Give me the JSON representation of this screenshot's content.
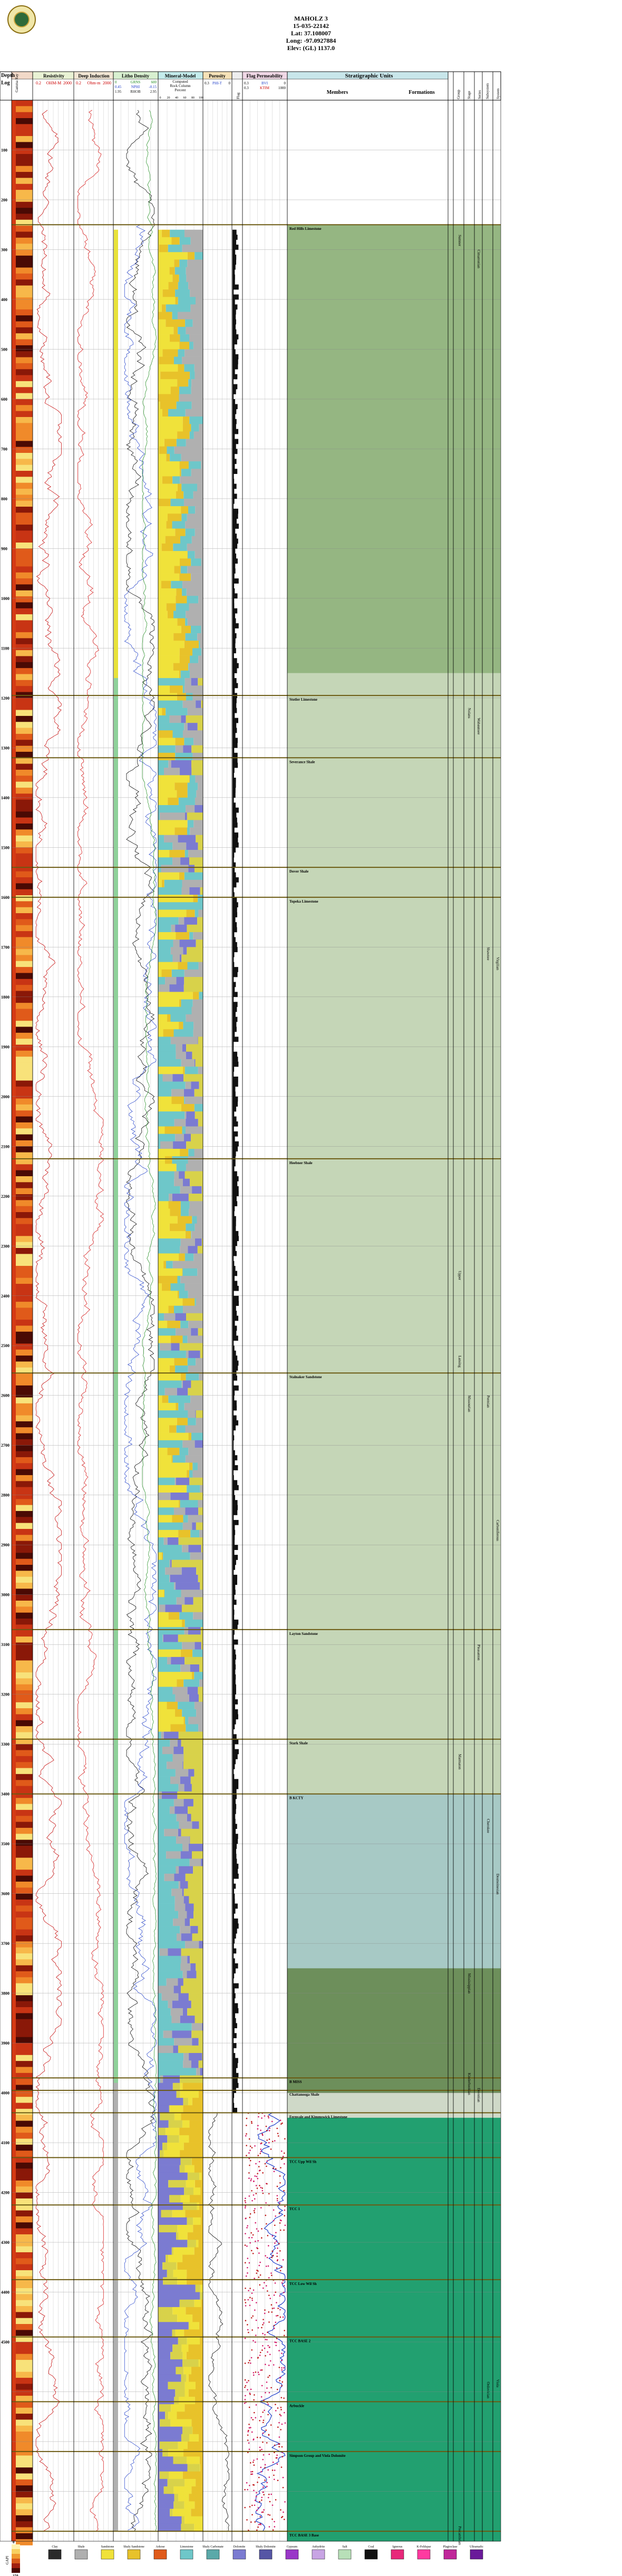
{
  "header": {
    "well_name": "MAHOLZ 3",
    "api": "15-035-22142",
    "lat": "Lat: 37.108007",
    "long": "Long: -97.0927884",
    "elev": "Elev: (GL) 1137.0"
  },
  "columns": {
    "depth": "Depth",
    "log": "Log",
    "gamma_ray": "Gamma Ray",
    "gr_scale": [
      "0",
      "GAPI",
      "150"
    ],
    "resistivity": "Resistivity",
    "res_scale": [
      "0.2",
      "OHM-M",
      "2000"
    ],
    "deep_induction": "Deep Induction",
    "deep_scale": [
      "0.2",
      "Ohm-m",
      "2000"
    ],
    "litho_density": "Litho Density",
    "ld_curves": [
      {
        "name": "GRNS",
        "range": [
          "0",
          "600"
        ]
      },
      {
        "name": "NPHI",
        "range": [
          "0.45",
          "-0.15"
        ]
      },
      {
        "name": "RHOB",
        "range": [
          "1.95",
          "2.95"
        ]
      }
    ],
    "mineral_model": "Mineral-Model",
    "mm_sub": [
      "Computed",
      "Rock Column",
      "Percent"
    ],
    "mm_ticks": [
      "0",
      "20",
      "40",
      "60",
      "80",
      "100"
    ],
    "porosity": "Porosity",
    "por_scale": [
      "0.3",
      "PHI-T",
      "0"
    ],
    "flag": "Flag",
    "flag_perm": "Flag Permeability",
    "fp_scale": [
      "0.3",
      "BVI",
      "0"
    ],
    "fp_scale2": [
      "0.3",
      "KTIM",
      "1000"
    ],
    "strat": "Stratigraphic Units",
    "members": "Members",
    "formations": "Formations",
    "groups": [
      "Group",
      "Stage",
      "Series",
      "Subsystem",
      "System"
    ]
  },
  "chart_data": {
    "type": "well-log",
    "depth_axis": {
      "label": "Depth",
      "range": [
        0,
        4900
      ],
      "ticks": [
        100,
        200,
        300,
        400,
        500,
        600,
        700,
        800,
        900,
        1000,
        1100,
        1200,
        1300,
        1400,
        1500,
        1600,
        1700,
        1800,
        1900,
        2000,
        2100,
        2200,
        2300,
        2400,
        2500,
        2600,
        2700,
        2800,
        2900,
        3000,
        3100,
        3200,
        3300,
        3400,
        3500,
        3600,
        3700,
        3800,
        3900,
        4000,
        4100,
        4200,
        4300,
        4400,
        4500
      ]
    },
    "tops": [
      {
        "name": "Red Hills Limestone",
        "depth": 250
      },
      {
        "name": "Stotler Limestone",
        "depth": 1195
      },
      {
        "name": "Severance Shale",
        "depth": 1320
      },
      {
        "name": "Dover Shale",
        "depth": 1540
      },
      {
        "name": "Topeka Limestone",
        "depth": 1600
      },
      {
        "name": "Heebner Shale",
        "depth": 2125
      },
      {
        "name": "Stalnaker Sandstone",
        "depth": 2555
      },
      {
        "name": "Layton Sandstone",
        "depth": 3070
      },
      {
        "name": "Stark Shale",
        "depth": 3290
      },
      {
        "name": "B KCTY",
        "depth": 3400
      },
      {
        "name": "B MISS",
        "depth": 3970
      },
      {
        "name": "Chattanooga Shale",
        "depth": 3995
      },
      {
        "name": "Fernvale and Kimmswick Limestone",
        "depth": 4040
      },
      {
        "name": "TCC Upp Wil Sh",
        "depth": 4130
      },
      {
        "name": "TCC 1",
        "depth": 4225
      },
      {
        "name": "TCC Low Wil Sh",
        "depth": 4375
      },
      {
        "name": "TCC BASE 2",
        "depth": 4490
      },
      {
        "name": "Arbuckle",
        "depth": 4620
      },
      {
        "name": "Simpson Group and Viola Dolomite",
        "depth": 4720
      },
      {
        "name": "TCC BASE 3 Base",
        "depth": 4880
      }
    ],
    "strat_labels": [
      {
        "text": "Sumner",
        "depth": 270
      },
      {
        "text": "Nolans",
        "depth": 1220
      },
      {
        "text": "Wabaunsee",
        "depth": 1240
      },
      {
        "text": "Shawnee",
        "depth": 1700
      },
      {
        "text": "Virgilian",
        "depth": 1720
      },
      {
        "text": "Lansing",
        "depth": 2520
      },
      {
        "text": "Missourian",
        "depth": 2600
      },
      {
        "text": "Pleasanton",
        "depth": 3100
      },
      {
        "text": "Cherokee",
        "depth": 3450
      },
      {
        "text": "Desmoinesian",
        "depth": 3560
      },
      {
        "text": "Marmaton",
        "depth": 3320
      },
      {
        "text": "Mississippian",
        "depth": 3760
      },
      {
        "text": "Cimarronian",
        "depth": 300
      },
      {
        "text": "Permian",
        "depth": 2600
      },
      {
        "text": "Carboniferous",
        "depth": 2850
      },
      {
        "text": "Upper",
        "depth": 2350
      },
      {
        "text": "Kinderhookian",
        "depth": 3960
      },
      {
        "text": "Devonian",
        "depth": 3990
      },
      {
        "text": "Ordovician",
        "depth": 4580
      },
      {
        "text": "Viola",
        "depth": 4575
      },
      {
        "text": "Precambrian",
        "depth": 4870
      }
    ],
    "legend": [
      {
        "name": "Clay",
        "color": "#2b2b2b"
      },
      {
        "name": "Shale",
        "color": "#b0b0b0"
      },
      {
        "name": "Sandstone",
        "color": "#f0e23a"
      },
      {
        "name": "Shaly Sandstone",
        "color": "#e8c22a"
      },
      {
        "name": "Arkose",
        "color": "#e05b1b"
      },
      {
        "name": "Limestone",
        "color": "#6ec7c9"
      },
      {
        "name": "Shaly Carbonate",
        "color": "#5aa9a9"
      },
      {
        "name": "Dolomite",
        "color": "#7b7bd1"
      },
      {
        "name": "Shaly Dolomite",
        "color": "#5656a5"
      },
      {
        "name": "Gypsum",
        "color": "#9a37c8"
      },
      {
        "name": "Anhydrite",
        "color": "#c8a4e4"
      },
      {
        "name": "Salt",
        "color": "#b8e0b8"
      },
      {
        "name": "Coal",
        "color": "#111111"
      },
      {
        "name": "Igneous",
        "color": "#e8287a"
      },
      {
        "name": "K-Feldspar",
        "color": "#ff3aa0"
      },
      {
        "name": "Plagioclase",
        "color": "#c0269a"
      },
      {
        "name": "Ultramafic",
        "color": "#6a1a9a"
      }
    ],
    "colorbar": {
      "label": "GAPI",
      "range": [
        "0",
        "150"
      ]
    }
  }
}
